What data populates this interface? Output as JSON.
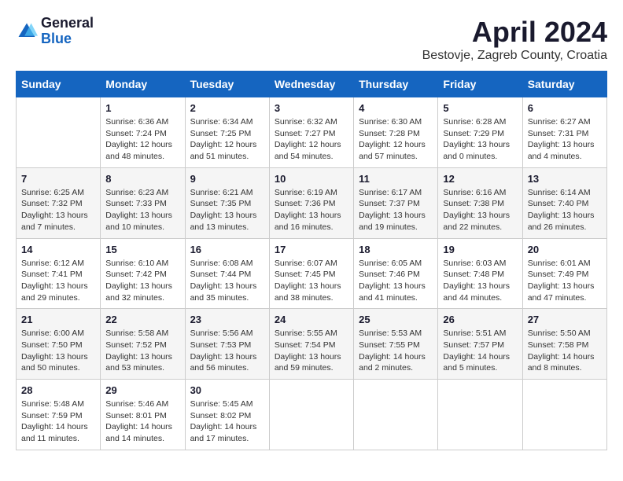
{
  "header": {
    "logo_general": "General",
    "logo_blue": "Blue",
    "month_title": "April 2024",
    "location": "Bestovje, Zagreb County, Croatia"
  },
  "calendar": {
    "weekdays": [
      "Sunday",
      "Monday",
      "Tuesday",
      "Wednesday",
      "Thursday",
      "Friday",
      "Saturday"
    ],
    "weeks": [
      [
        {
          "day": "",
          "info": ""
        },
        {
          "day": "1",
          "info": "Sunrise: 6:36 AM\nSunset: 7:24 PM\nDaylight: 12 hours\nand 48 minutes."
        },
        {
          "day": "2",
          "info": "Sunrise: 6:34 AM\nSunset: 7:25 PM\nDaylight: 12 hours\nand 51 minutes."
        },
        {
          "day": "3",
          "info": "Sunrise: 6:32 AM\nSunset: 7:27 PM\nDaylight: 12 hours\nand 54 minutes."
        },
        {
          "day": "4",
          "info": "Sunrise: 6:30 AM\nSunset: 7:28 PM\nDaylight: 12 hours\nand 57 minutes."
        },
        {
          "day": "5",
          "info": "Sunrise: 6:28 AM\nSunset: 7:29 PM\nDaylight: 13 hours\nand 0 minutes."
        },
        {
          "day": "6",
          "info": "Sunrise: 6:27 AM\nSunset: 7:31 PM\nDaylight: 13 hours\nand 4 minutes."
        }
      ],
      [
        {
          "day": "7",
          "info": "Sunrise: 6:25 AM\nSunset: 7:32 PM\nDaylight: 13 hours\nand 7 minutes."
        },
        {
          "day": "8",
          "info": "Sunrise: 6:23 AM\nSunset: 7:33 PM\nDaylight: 13 hours\nand 10 minutes."
        },
        {
          "day": "9",
          "info": "Sunrise: 6:21 AM\nSunset: 7:35 PM\nDaylight: 13 hours\nand 13 minutes."
        },
        {
          "day": "10",
          "info": "Sunrise: 6:19 AM\nSunset: 7:36 PM\nDaylight: 13 hours\nand 16 minutes."
        },
        {
          "day": "11",
          "info": "Sunrise: 6:17 AM\nSunset: 7:37 PM\nDaylight: 13 hours\nand 19 minutes."
        },
        {
          "day": "12",
          "info": "Sunrise: 6:16 AM\nSunset: 7:38 PM\nDaylight: 13 hours\nand 22 minutes."
        },
        {
          "day": "13",
          "info": "Sunrise: 6:14 AM\nSunset: 7:40 PM\nDaylight: 13 hours\nand 26 minutes."
        }
      ],
      [
        {
          "day": "14",
          "info": "Sunrise: 6:12 AM\nSunset: 7:41 PM\nDaylight: 13 hours\nand 29 minutes."
        },
        {
          "day": "15",
          "info": "Sunrise: 6:10 AM\nSunset: 7:42 PM\nDaylight: 13 hours\nand 32 minutes."
        },
        {
          "day": "16",
          "info": "Sunrise: 6:08 AM\nSunset: 7:44 PM\nDaylight: 13 hours\nand 35 minutes."
        },
        {
          "day": "17",
          "info": "Sunrise: 6:07 AM\nSunset: 7:45 PM\nDaylight: 13 hours\nand 38 minutes."
        },
        {
          "day": "18",
          "info": "Sunrise: 6:05 AM\nSunset: 7:46 PM\nDaylight: 13 hours\nand 41 minutes."
        },
        {
          "day": "19",
          "info": "Sunrise: 6:03 AM\nSunset: 7:48 PM\nDaylight: 13 hours\nand 44 minutes."
        },
        {
          "day": "20",
          "info": "Sunrise: 6:01 AM\nSunset: 7:49 PM\nDaylight: 13 hours\nand 47 minutes."
        }
      ],
      [
        {
          "day": "21",
          "info": "Sunrise: 6:00 AM\nSunset: 7:50 PM\nDaylight: 13 hours\nand 50 minutes."
        },
        {
          "day": "22",
          "info": "Sunrise: 5:58 AM\nSunset: 7:52 PM\nDaylight: 13 hours\nand 53 minutes."
        },
        {
          "day": "23",
          "info": "Sunrise: 5:56 AM\nSunset: 7:53 PM\nDaylight: 13 hours\nand 56 minutes."
        },
        {
          "day": "24",
          "info": "Sunrise: 5:55 AM\nSunset: 7:54 PM\nDaylight: 13 hours\nand 59 minutes."
        },
        {
          "day": "25",
          "info": "Sunrise: 5:53 AM\nSunset: 7:55 PM\nDaylight: 14 hours\nand 2 minutes."
        },
        {
          "day": "26",
          "info": "Sunrise: 5:51 AM\nSunset: 7:57 PM\nDaylight: 14 hours\nand 5 minutes."
        },
        {
          "day": "27",
          "info": "Sunrise: 5:50 AM\nSunset: 7:58 PM\nDaylight: 14 hours\nand 8 minutes."
        }
      ],
      [
        {
          "day": "28",
          "info": "Sunrise: 5:48 AM\nSunset: 7:59 PM\nDaylight: 14 hours\nand 11 minutes."
        },
        {
          "day": "29",
          "info": "Sunrise: 5:46 AM\nSunset: 8:01 PM\nDaylight: 14 hours\nand 14 minutes."
        },
        {
          "day": "30",
          "info": "Sunrise: 5:45 AM\nSunset: 8:02 PM\nDaylight: 14 hours\nand 17 minutes."
        },
        {
          "day": "",
          "info": ""
        },
        {
          "day": "",
          "info": ""
        },
        {
          "day": "",
          "info": ""
        },
        {
          "day": "",
          "info": ""
        }
      ]
    ]
  }
}
